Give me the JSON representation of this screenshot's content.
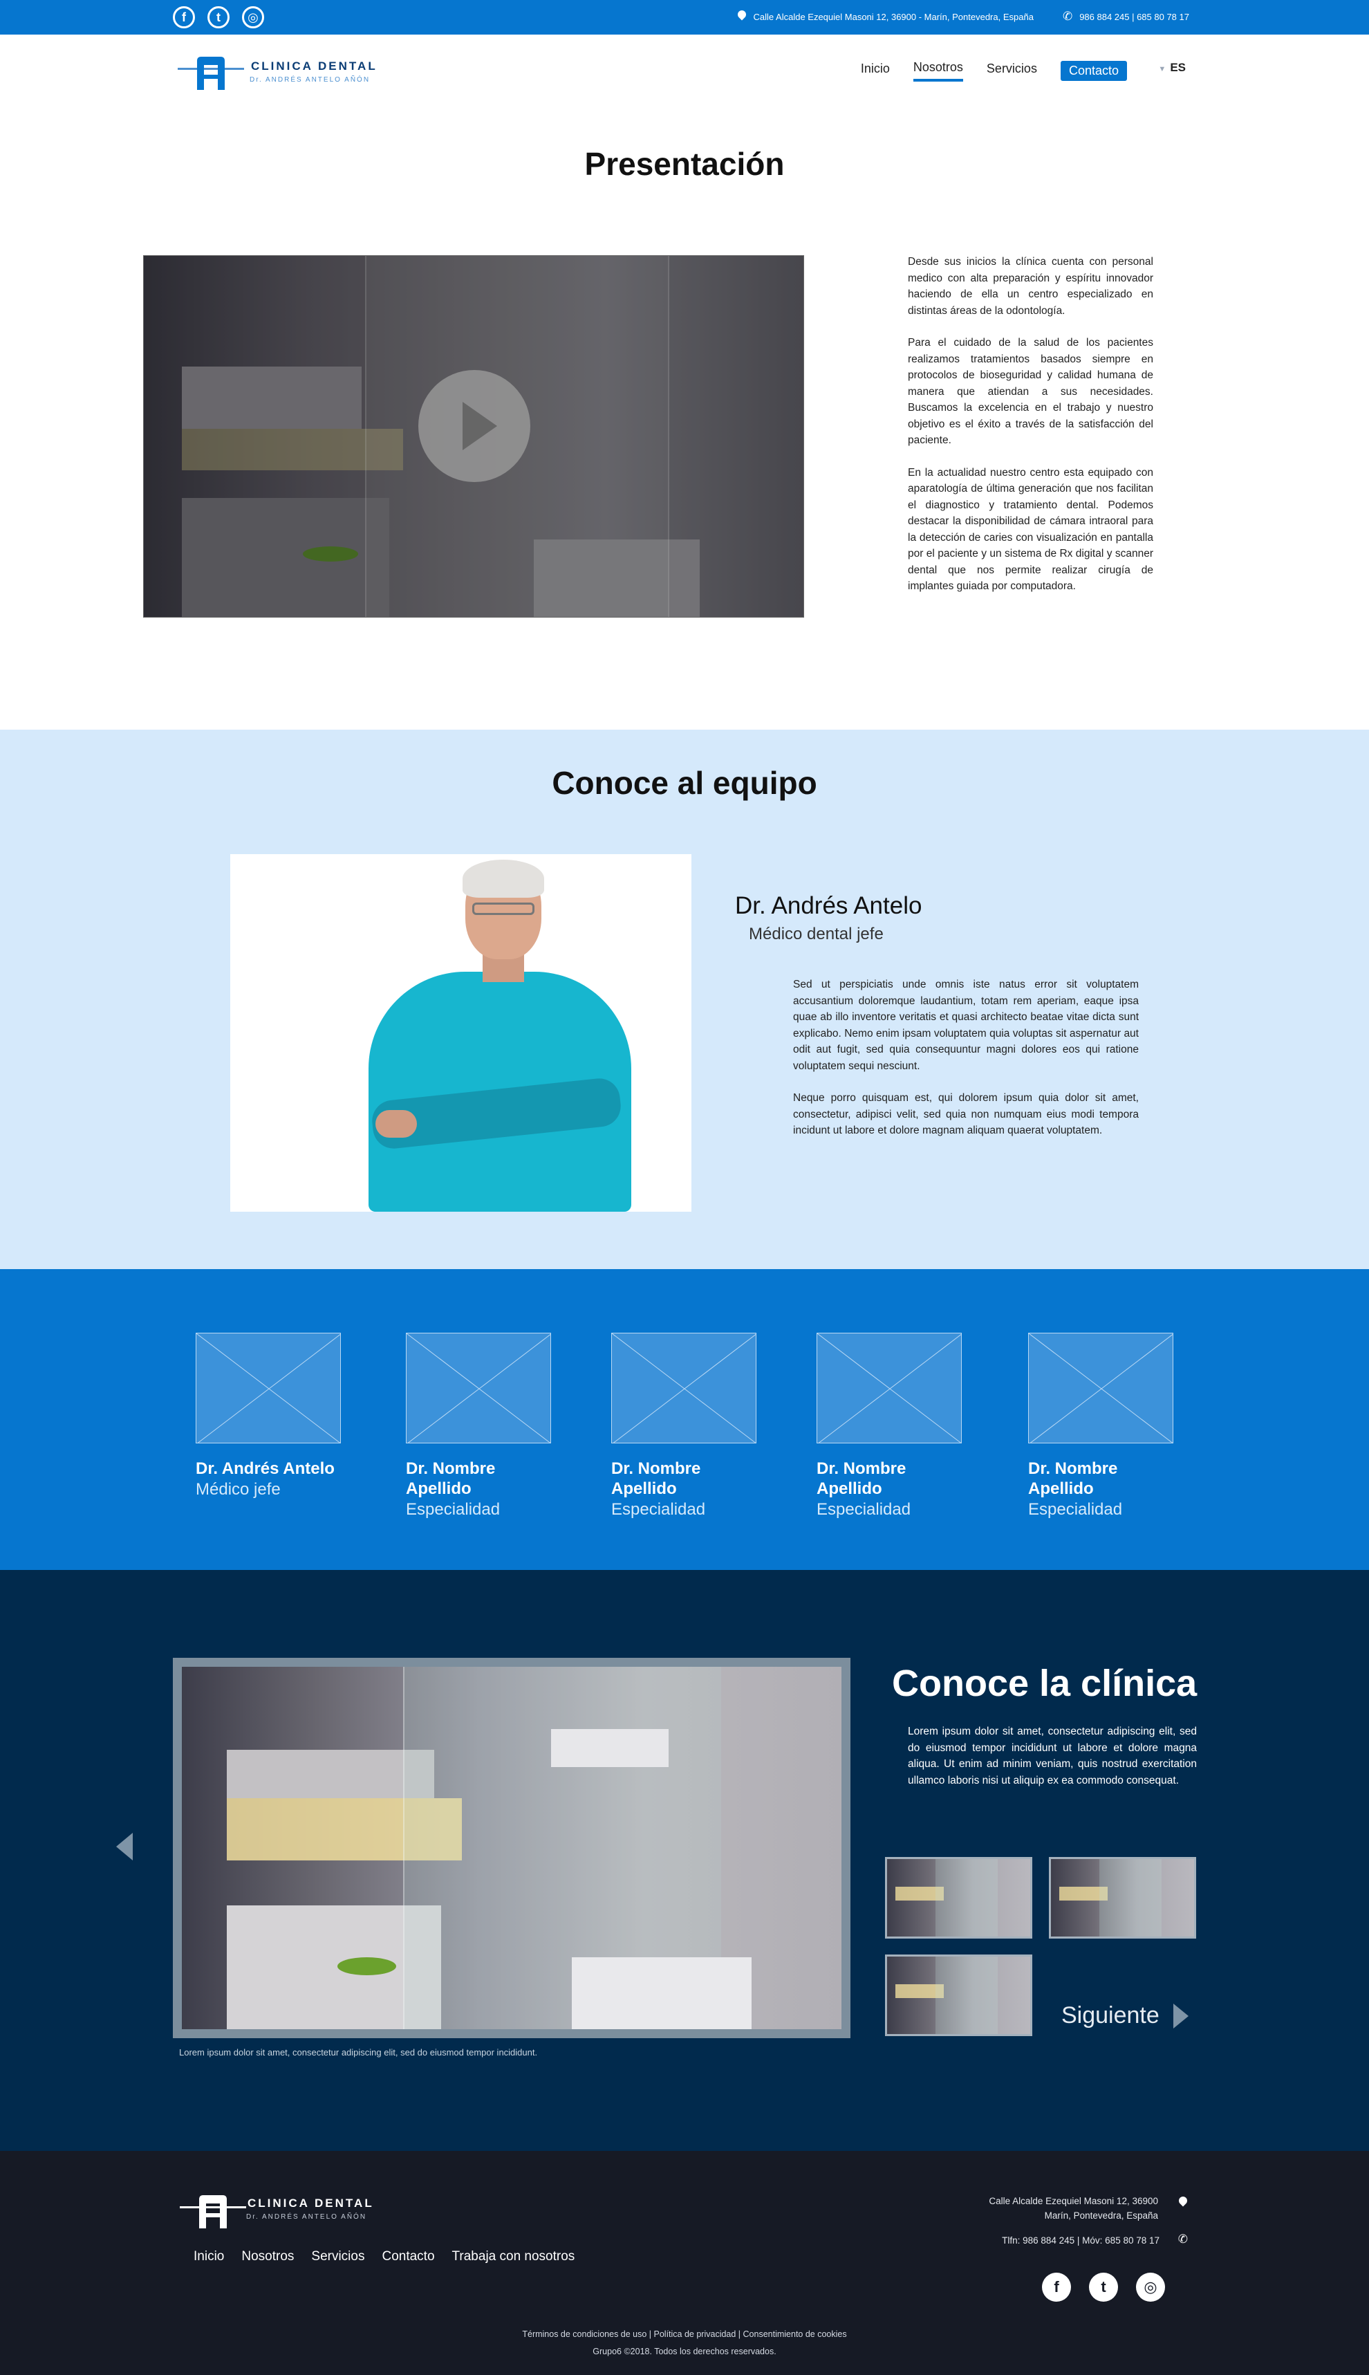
{
  "topbar": {
    "address": "Calle Alcalde Ezequiel Masoni 12, 36900 - Marín, Pontevedra, España",
    "phones": "986 884 245  |  685 80 78 17",
    "social": [
      {
        "icon": "facebook-icon",
        "glyph": "f"
      },
      {
        "icon": "twitter-icon",
        "glyph": "t"
      },
      {
        "icon": "instagram-icon",
        "glyph": "◎"
      }
    ]
  },
  "logo": {
    "title": "CLINICA DENTAL",
    "subtitle": "Dr. ANDRÉS ANTELO AÑÓN"
  },
  "nav": {
    "items": [
      {
        "label": "Inicio",
        "active": false
      },
      {
        "label": "Nosotros",
        "active": true
      },
      {
        "label": "Servicios",
        "active": false
      }
    ],
    "contact_label": "Contacto",
    "language": "ES"
  },
  "presentacion": {
    "title": "Presentación",
    "paragraphs": [
      "Desde sus inicios la clínica cuenta con personal medico con alta preparación y espíritu innovador haciendo de ella un centro especializado en distintas áreas de la odontología.",
      "Para el cuidado de la salud de los pacientes realizamos tratamientos basados siempre en protocolos de bioseguridad y calidad humana de manera que atiendan a sus necesidades. Buscamos la excelencia en el trabajo y nuestro objetivo es el éxito a través de la satisfacción del paciente.",
      "En la actualidad nuestro centro esta equipado con aparatología de última generación que nos facilitan el diagnostico y tratamiento dental. Podemos destacar la disponibilidad de cámara intraoral para la detección de caries con visualización en pantalla por el paciente y un sistema de Rx digital y scanner dental que nos permite realizar cirugía de implantes guiada por computadora."
    ]
  },
  "equipo": {
    "title": "Conoce al equipo",
    "doctor_name": "Dr. Andrés Antelo",
    "doctor_role": "Médico dental jefe",
    "paragraphs": [
      "Sed ut perspiciatis unde omnis iste natus error sit voluptatem accusantium doloremque laudantium, totam rem aperiam, eaque ipsa quae ab illo inventore veritatis et quasi architecto beatae vitae dicta sunt explicabo. Nemo enim ipsam voluptatem quia voluptas sit aspernatur aut odit aut fugit, sed quia consequuntur magni dolores eos qui ratione voluptatem sequi nesciunt.",
      "Neque porro quisquam est, qui dolorem ipsum quia dolor sit amet, consectetur, adipisci velit, sed quia non numquam eius modi tempora incidunt ut labore et dolore magnam aliquam quaerat voluptatem."
    ]
  },
  "team": [
    {
      "name": "Dr. Andrés Antelo",
      "role": "Médico jefe"
    },
    {
      "name": "Dr. Nombre Apellido",
      "role": "Especialidad"
    },
    {
      "name": "Dr. Nombre Apellido",
      "role": "Especialidad"
    },
    {
      "name": "Dr. Nombre Apellido",
      "role": "Especialidad"
    },
    {
      "name": "Dr. Nombre Apellido",
      "role": "Especialidad"
    }
  ],
  "clinica": {
    "title": "Conoce la clínica",
    "text": "Lorem ipsum dolor sit amet, consectetur adipiscing elit, sed do eiusmod tempor incididunt ut labore et dolore magna aliqua. Ut enim ad minim veniam, quis nostrud exercitation ullamco laboris nisi ut aliquip ex ea commodo consequat.",
    "caption": "Lorem ipsum dolor sit amet, consectetur adipiscing elit, sed do eiusmod tempor incididunt.",
    "next_label": "Siguiente"
  },
  "footer": {
    "logo_title": "CLINICA DENTAL",
    "logo_subtitle": "Dr. ANDRÉS ANTELO AÑÓN",
    "menu": [
      "Inicio",
      "Nosotros",
      "Servicios",
      "Contacto",
      "Trabaja con nosotros"
    ],
    "address_line1": "Calle Alcalde Ezequiel Masoni 12, 36900",
    "address_line2": "Marín, Pontevedra, España",
    "phones": "Tlfn: 986 884 245  |  Móv: 685 80 78 17",
    "legal": "Términos de condiciones de uso  |  Política de privacidad  |  Consentimiento de cookies",
    "copyright": "Grupo6 ©2018. Todos los derechos reservados."
  },
  "colors": {
    "primary_blue": "#0676cf",
    "light_blue": "#d5e9fb",
    "navy": "#012a4d",
    "footer_dark": "#161a25"
  }
}
